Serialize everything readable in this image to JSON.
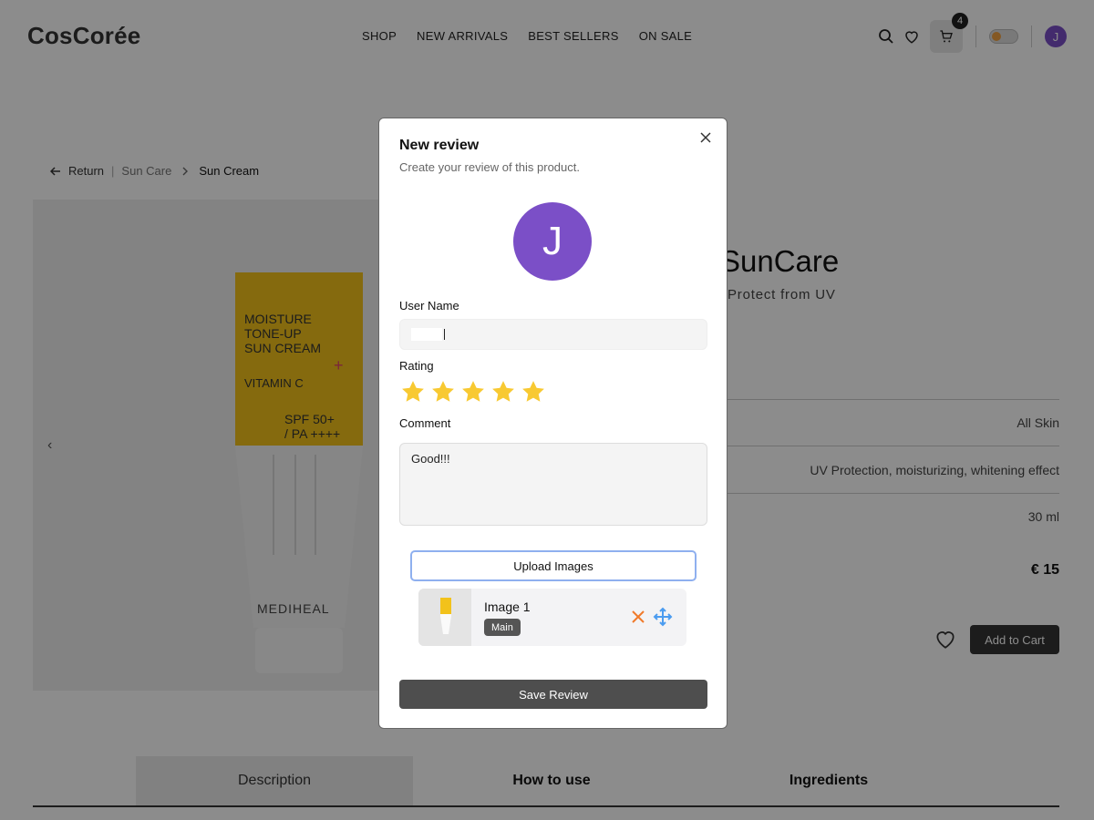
{
  "header": {
    "logo": "CosCorée",
    "nav": [
      "SHOP",
      "NEW ARRIVALS",
      "BEST SELLERS",
      "ON SALE"
    ],
    "cart_count": "4",
    "avatar_initial": "J"
  },
  "breadcrumb": {
    "return_label": "Return",
    "category": "Sun Care",
    "current": "Sun Cream"
  },
  "product": {
    "title_partial": "SunCare",
    "subtitle_partial": "Protect from UV",
    "attributes": [
      "All Skin",
      "UV Protection, moisturizing, whitening effect",
      "30 ml"
    ],
    "price": "€ 15",
    "add_to_cart_label": "Add to Cart",
    "tube_text": {
      "line1": "MOISTURE",
      "line2": "TONE-UP",
      "line3": "SUN CREAM",
      "line4": "VITAMIN C",
      "spf": "SPF 50+",
      "pa": "/ PA ++++",
      "brand": "MEDIHEAL"
    }
  },
  "tabs": [
    "Description",
    "How to use",
    "Ingredients"
  ],
  "modal": {
    "title": "New review",
    "subtitle": "Create your review of this product.",
    "avatar_initial": "J",
    "username_label": "User Name",
    "username_value": "",
    "rating_label": "Rating",
    "rating_value": 5,
    "rating_max": 5,
    "comment_label": "Comment",
    "comment_value": "Good!!!",
    "upload_label": "Upload Images",
    "images": [
      {
        "name": "Image 1",
        "badge": "Main"
      }
    ],
    "save_label": "Save Review"
  },
  "colors": {
    "avatar": "#7b4fc7",
    "star": "#f8c932",
    "remove": "#f07a2a",
    "move": "#4b9cf0",
    "upload_border": "#8fb0ef"
  }
}
